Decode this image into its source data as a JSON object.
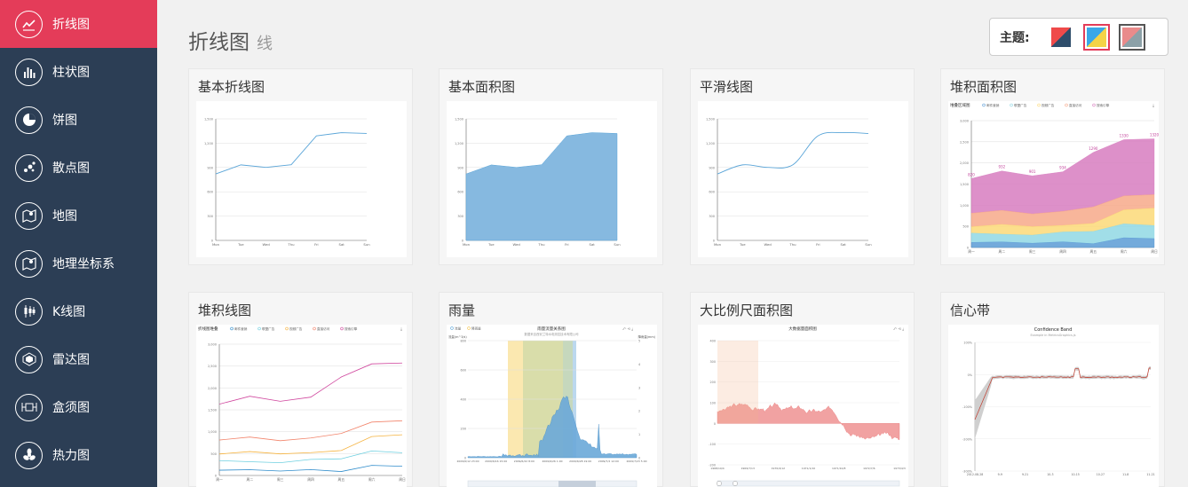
{
  "sidebar": {
    "items": [
      {
        "label": "折线图",
        "icon": "line-chart-icon",
        "active": true
      },
      {
        "label": "柱状图",
        "icon": "bar-chart-icon",
        "active": false
      },
      {
        "label": "饼图",
        "icon": "pie-chart-icon",
        "active": false
      },
      {
        "label": "散点图",
        "icon": "scatter-icon",
        "active": false
      },
      {
        "label": "地图",
        "icon": "map-icon",
        "active": false
      },
      {
        "label": "地理坐标系",
        "icon": "geo-icon",
        "active": false
      },
      {
        "label": "K线图",
        "icon": "candlestick-icon",
        "active": false
      },
      {
        "label": "雷达图",
        "icon": "radar-icon",
        "active": false
      },
      {
        "label": "盒须图",
        "icon": "boxplot-icon",
        "active": false
      },
      {
        "label": "热力图",
        "icon": "heatmap-icon",
        "active": false
      }
    ]
  },
  "header": {
    "title": "折线图",
    "subtitle": "线"
  },
  "theme": {
    "label": "主题:"
  },
  "cards": [
    {
      "title": "基本折线图"
    },
    {
      "title": "基本面积图"
    },
    {
      "title": "平滑线图"
    },
    {
      "title": "堆积面积图",
      "inner_title": "堆叠区域图",
      "legend": [
        "邮件营销",
        "联盟广告",
        "视频广告",
        "直接访问",
        "搜索引擎"
      ],
      "labels": [
        "820",
        "932",
        "901",
        "934",
        "1290",
        "1330",
        "1320"
      ]
    },
    {
      "title": "堆积线图",
      "inner_title": "折线图堆叠",
      "legend": [
        "邮件营销",
        "联盟广告",
        "视频广告",
        "直接访问",
        "搜索引擎"
      ]
    },
    {
      "title": "雨量",
      "inner_title": "雨量流量关系图",
      "inner_subtitle": "数据来自西安兰特水电测控技术有限公司",
      "legend": [
        "流量",
        "降雨量"
      ],
      "yl": "流量(m^3/s)",
      "yr": "降雨量(mm)"
    },
    {
      "title": "大比例尺面积图",
      "inner_title": "大数据量面积图"
    },
    {
      "title": "信心带",
      "inner_title": "Confidence Band",
      "inner_subtitle": "Example in MetricsGraphics.js"
    }
  ],
  "chart_data": [
    {
      "type": "line",
      "categories": [
        "Mon",
        "Tue",
        "Wed",
        "Thu",
        "Fri",
        "Sat",
        "Sun"
      ],
      "values": [
        820,
        932,
        901,
        934,
        1290,
        1330,
        1320
      ],
      "ylim": [
        0,
        1500
      ],
      "yticks": [
        "0",
        "300",
        "600",
        "900",
        "1,200",
        "1,500"
      ]
    },
    {
      "type": "area",
      "categories": [
        "Mon",
        "Tue",
        "Wed",
        "Thu",
        "Fri",
        "Sat",
        "Sun"
      ],
      "values": [
        820,
        932,
        901,
        934,
        1290,
        1330,
        1320
      ],
      "ylim": [
        0,
        1500
      ],
      "yticks": [
        "0",
        "300",
        "600",
        "900",
        "1,200",
        "1,500"
      ]
    },
    {
      "type": "line",
      "smooth": true,
      "categories": [
        "Mon",
        "Tue",
        "Wed",
        "Thu",
        "Fri",
        "Sat",
        "Sun"
      ],
      "values": [
        820,
        932,
        901,
        934,
        1290,
        1330,
        1320
      ],
      "ylim": [
        0,
        1500
      ],
      "yticks": [
        "0",
        "300",
        "600",
        "900",
        "1,200",
        "1,500"
      ]
    },
    {
      "type": "area",
      "stacked": true,
      "categories": [
        "周一",
        "周二",
        "周三",
        "周四",
        "周五",
        "周六",
        "周日"
      ],
      "ylim": [
        0,
        3000
      ],
      "yticks": [
        "0",
        "500",
        "1,000",
        "1,500",
        "2,000",
        "2,500",
        "3,000"
      ],
      "series": [
        {
          "name": "邮件营销",
          "values": [
            120,
            132,
            101,
            134,
            90,
            230,
            210
          ]
        },
        {
          "name": "联盟广告",
          "values": [
            220,
            182,
            191,
            234,
            290,
            330,
            310
          ]
        },
        {
          "name": "视频广告",
          "values": [
            150,
            232,
            201,
            154,
            190,
            330,
            410
          ]
        },
        {
          "name": "直接访问",
          "values": [
            320,
            332,
            301,
            334,
            390,
            330,
            320
          ]
        },
        {
          "name": "搜索引擎",
          "values": [
            820,
            932,
            901,
            934,
            1290,
            1330,
            1320
          ]
        }
      ],
      "colors": [
        "#5a9bd5",
        "#91d8e4",
        "#fcd978",
        "#f7a98a",
        "#d77dbf"
      ]
    },
    {
      "type": "line",
      "stacked": true,
      "categories": [
        "周一",
        "周二",
        "周三",
        "周四",
        "周五",
        "周六",
        "周日"
      ],
      "ylim": [
        0,
        3000
      ],
      "yticks": [
        "0",
        "500",
        "1,000",
        "1,500",
        "2,000",
        "2,500",
        "3,000"
      ],
      "series": [
        {
          "name": "邮件营销",
          "values": [
            120,
            132,
            101,
            134,
            90,
            230,
            210
          ]
        },
        {
          "name": "联盟广告",
          "values": [
            220,
            182,
            191,
            234,
            290,
            330,
            310
          ]
        },
        {
          "name": "视频广告",
          "values": [
            150,
            232,
            201,
            154,
            190,
            330,
            410
          ]
        },
        {
          "name": "直接访问",
          "values": [
            320,
            332,
            301,
            334,
            390,
            330,
            320
          ]
        },
        {
          "name": "搜索引擎",
          "values": [
            820,
            932,
            901,
            934,
            1290,
            1330,
            1320
          ]
        }
      ],
      "colors": [
        "#2f8ccb",
        "#6fd0e0",
        "#f5b340",
        "#f2846b",
        "#d0479e"
      ]
    },
    {
      "type": "area",
      "dual_axis": true,
      "ylim": [
        0,
        800
      ],
      "ylim_right": [
        0,
        5
      ],
      "yticks": [
        "0",
        "200",
        "400",
        "600",
        "800"
      ],
      "yticks_right": [
        "5",
        "4",
        "3",
        "2",
        "1",
        "0"
      ],
      "xticks": [
        "2009/6/12 23:00",
        "2009/6/16 15:00",
        "2009/6/22 8:00",
        "2009/6/26 1:00",
        "2009/6/28 19:00",
        "2009/7/2 12:00",
        "2009/7/23 5:00"
      ]
    },
    {
      "type": "area",
      "ylim": [
        -200,
        400
      ],
      "yticks": [
        "400",
        "300",
        "200",
        "100",
        "0",
        "-100",
        "-200"
      ],
      "xticks": [
        "1968/10/4",
        "1969/7/13",
        "1970/4/12",
        "1971/1/10",
        "1971/10/8",
        "1972/7/6",
        "1973/4/3"
      ]
    },
    {
      "type": "line",
      "band": true,
      "ylim": [
        -300,
        100
      ],
      "yticks": [
        "100%",
        "0%",
        "-100%",
        "-200%",
        "-300%"
      ],
      "xticks": [
        "2012-08-28",
        "9-9",
        "9-21",
        "10-3",
        "10-15",
        "10-27",
        "11-8",
        "11-21"
      ]
    }
  ]
}
